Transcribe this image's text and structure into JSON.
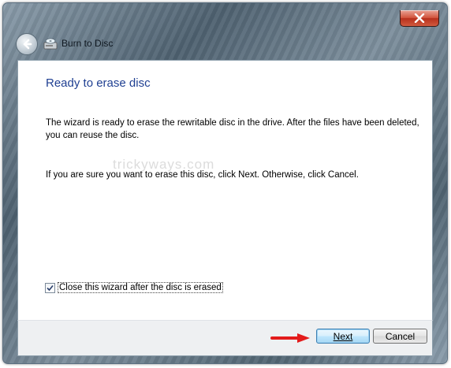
{
  "window": {
    "title": "Burn to Disc",
    "close_icon": "close-icon",
    "back_icon": "back-arrow-icon",
    "app_icon": "disc-burner-icon"
  },
  "content": {
    "heading": "Ready to erase disc",
    "paragraph1": "The wizard is ready to erase the rewritable disc in the drive. After the files have been deleted, you can reuse the disc.",
    "paragraph2": "If you are sure you want to erase this disc, click Next. Otherwise, click Cancel.",
    "watermark": "trickyways.com"
  },
  "options": {
    "close_after_label": "Close this wizard after the disc is erased",
    "close_after_checked": true
  },
  "footer": {
    "next_label": "Next",
    "cancel_label": "Cancel"
  },
  "colors": {
    "heading": "#1f3f92",
    "arrow": "#e31b1b",
    "close_button": "#c8452d"
  }
}
